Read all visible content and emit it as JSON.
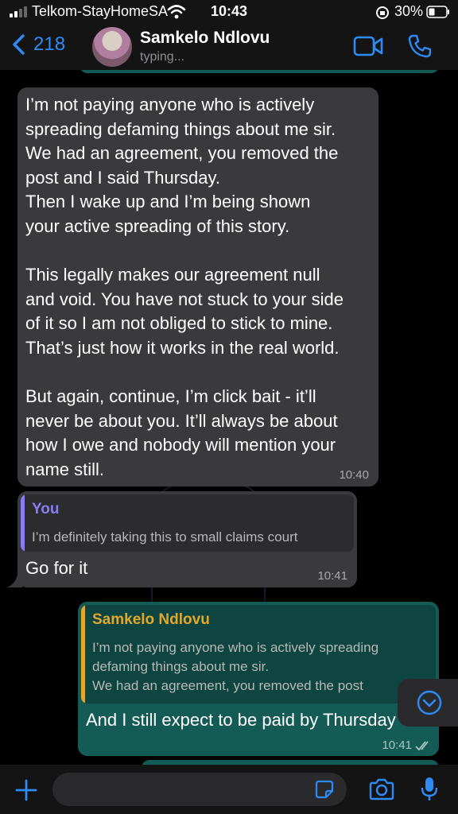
{
  "status_bar": {
    "carrier": "Telkom-StayHomeSA",
    "time": "10:43",
    "battery": "30%"
  },
  "header": {
    "back_count": "218",
    "contact_name": "Samkelo Ndlovu",
    "contact_status": "typing..."
  },
  "messages": [
    {
      "direction": "incoming",
      "text": "I’m not paying anyone who is actively\nspreading defaming things about me sir.\nWe had an agreement, you removed the\npost and I said Thursday.\nThen I wake up and I’m being shown\nyour active spreading of this story.\n\nThis legally makes our agreement null\nand void. You have not stuck to your side\nof it so I am not obliged to stick to mine.\nThat’s just how it works in the real world.\n\nBut again, continue, I’m click bait - it’ll\nnever be about you. It’ll always be about\nhow I owe and nobody will mention your\nname still.",
      "time": "10:40"
    },
    {
      "direction": "incoming",
      "quote_author": "You",
      "quote_text": "I’m definitely taking this to small claims court",
      "text": "Go for it",
      "time": "10:41"
    },
    {
      "direction": "outgoing",
      "quote_author": "Samkelo Ndlovu",
      "quote_text": "I’m not paying anyone who is actively spreading\ndefaming things about me sir.\nWe had an agreement, you removed the post",
      "text": "And I still expect to be paid by Thursday",
      "time": "10:41"
    }
  ],
  "colors": {
    "accent": "#2e8bf5",
    "incoming_bubble": "#3a3a3c",
    "outgoing_bubble": "#155b55",
    "quote_you": "#8a7cf0",
    "quote_contact": "#e0a92e"
  },
  "icons": [
    "signal-icon",
    "wifi-icon",
    "orientation-lock-icon",
    "battery-icon",
    "back-chevron-icon",
    "video-call-icon",
    "phone-call-icon",
    "scroll-down-icon",
    "plus-icon",
    "sticker-icon",
    "camera-icon",
    "microphone-icon",
    "read-receipt-icon"
  ]
}
